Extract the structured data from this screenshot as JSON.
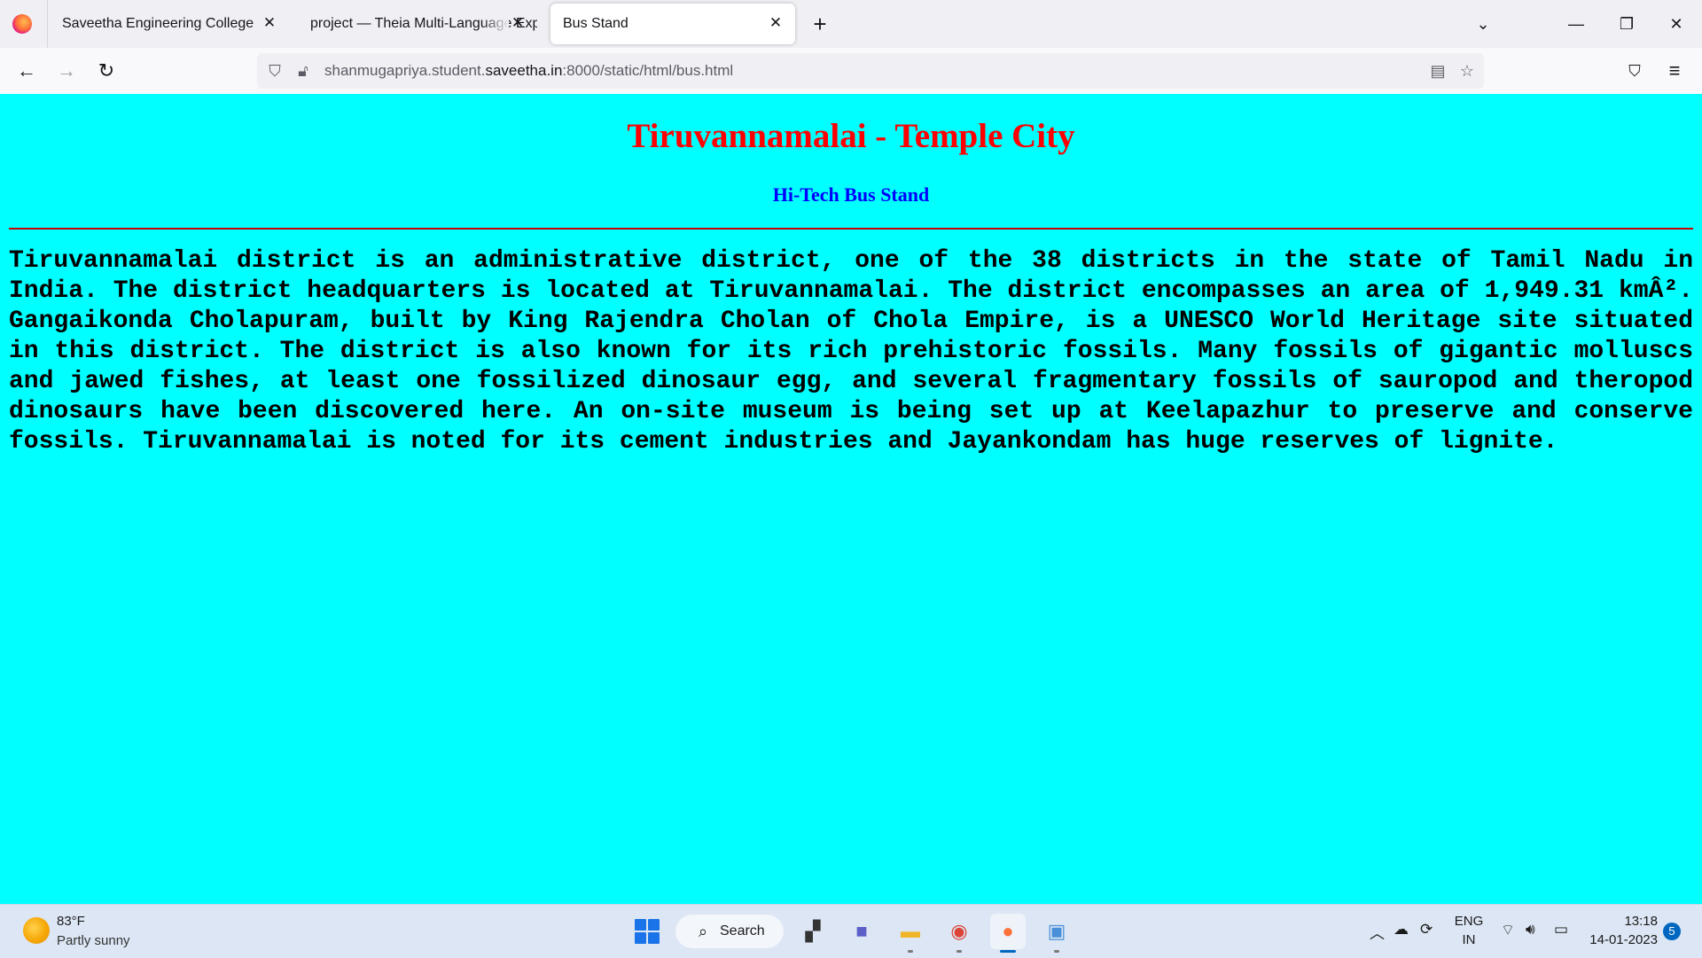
{
  "browser": {
    "tabs": [
      {
        "label": "Saveetha Engineering College",
        "active": false
      },
      {
        "label": "project — Theia Multi-Language Explorer",
        "active": false
      },
      {
        "label": "Bus Stand",
        "active": true
      }
    ],
    "tab_close_glyph": "✕",
    "new_tab_glyph": "+",
    "url": {
      "prefix": "shanmugapriya.student.",
      "host": "saveetha.in",
      "suffix": ":8000/static/html/bus.html"
    }
  },
  "page": {
    "background": "#00ffff",
    "title": "Tiruvannamalai - Temple City",
    "title_color": "#ff0000",
    "subtitle": "Hi-Tech Bus Stand",
    "subtitle_color": "#0000ff",
    "paragraph": "Tiruvannamalai district is an administrative district, one of the 38 districts in the state of Tamil Nadu in India. The district headquarters is located at Tiruvannamalai. The district encompasses an area of 1,949.31 kmÂ². Gangaikonda Cholapuram, built by King Rajendra Cholan of Chola Empire, is a UNESCO World Heritage site situated in this district. The district is also known for its rich prehistoric fossils. Many fossils of gigantic molluscs and jawed fishes, at least one fossilized dinosaur egg, and several fragmentary fossils of sauropod and theropod dinosaurs have been discovered here. An on-site museum is being set up at Keelapazhur to preserve and conserve fossils. Tiruvannamalai is noted for its cement industries and Jayankondam has huge reserves of lignite."
  },
  "taskbar": {
    "weather_temp": "83°F",
    "weather_desc": "Partly sunny",
    "search_label": "Search",
    "lang_top": "ENG",
    "lang_bottom": "IN",
    "time": "13:18",
    "date": "14-01-2023",
    "notification_count": "5"
  }
}
